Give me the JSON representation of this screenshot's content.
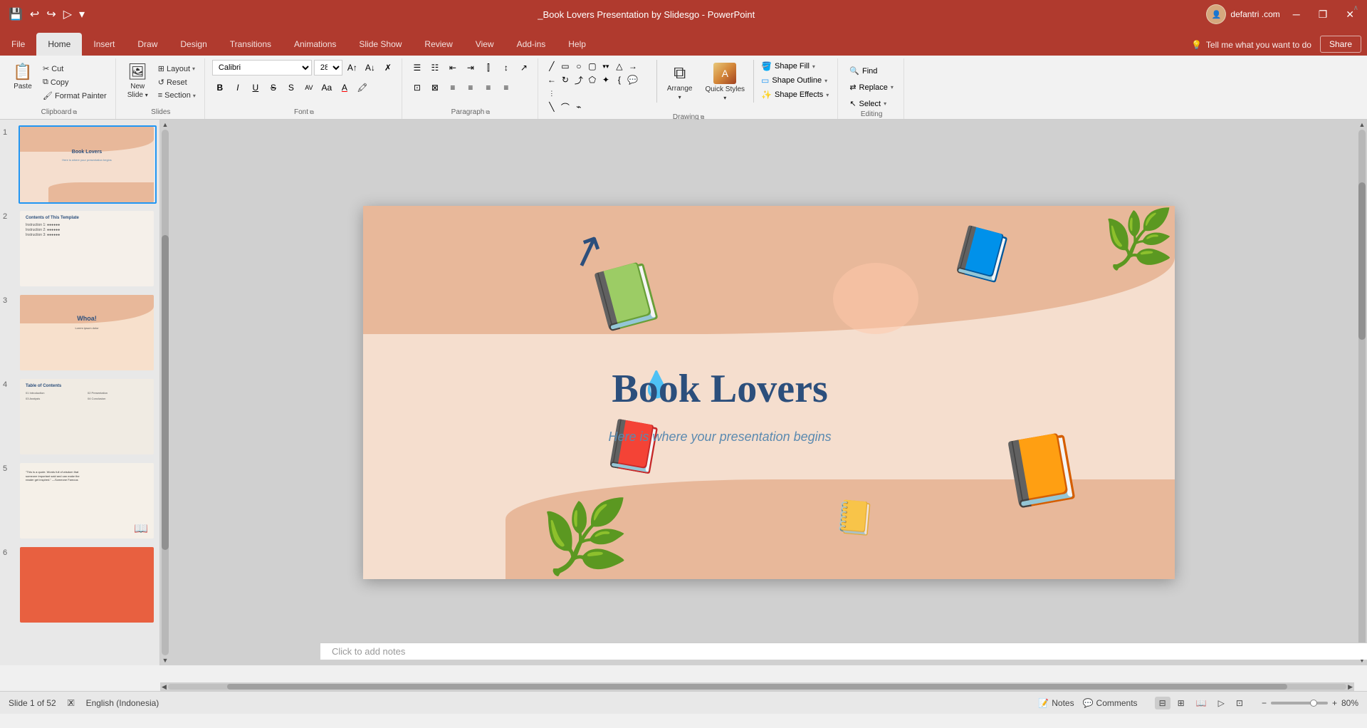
{
  "titlebar": {
    "title": "_Book Lovers Presentation by Slidesgo - PowerPoint",
    "user": "defantri .com",
    "minimize": "─",
    "restore": "❐",
    "close": "✕"
  },
  "tabs": {
    "items": [
      "File",
      "Home",
      "Insert",
      "Draw",
      "Design",
      "Transitions",
      "Animations",
      "Slide Show",
      "Review",
      "View",
      "Add-ins",
      "Help"
    ],
    "active": "Home",
    "tell_me": "Tell me what you want to do",
    "share": "Share"
  },
  "ribbon": {
    "clipboard": {
      "label": "Clipboard",
      "paste": "Paste",
      "cut": "Cut",
      "copy": "Copy",
      "format_painter": "Format Painter"
    },
    "slides": {
      "label": "Slides",
      "new_slide": "New Slide",
      "layout": "Layout",
      "reset": "Reset",
      "section": "Section"
    },
    "font": {
      "label": "Font",
      "font_name": "Calibri",
      "font_size": "28",
      "bold": "B",
      "italic": "I",
      "underline": "U",
      "strikethrough": "S",
      "shadow": "S",
      "expand": "A↕",
      "change_case": "Aa",
      "color": "A",
      "clear": "♦",
      "highlight": "A"
    },
    "paragraph": {
      "label": "Paragraph",
      "bullets": "☰",
      "numbering": "☷",
      "indent_less": "←",
      "indent_more": "→",
      "columns": "⊞",
      "align_left": "≡",
      "align_center": "≡",
      "align_right": "≡",
      "justify": "≡",
      "line_spacing": "↕",
      "text_direction": "⊡",
      "align_text": "⊠",
      "smart_art": "↗"
    },
    "drawing": {
      "label": "Drawing",
      "arrange": "Arrange",
      "quick_styles": "Quick Styles",
      "shape_fill": "Shape Fill",
      "shape_outline": "Shape Outline",
      "shape_effects": "Shape Effects"
    },
    "editing": {
      "label": "Editing",
      "find": "Find",
      "replace": "Replace",
      "select": "Select"
    }
  },
  "slides": [
    {
      "num": 1,
      "title": "Book Lovers",
      "subtitle": "Here is where your presentation begins",
      "selected": true
    },
    {
      "num": 2,
      "title": "Contents of This Template",
      "selected": false
    },
    {
      "num": 3,
      "title": "Whoa!",
      "selected": false
    },
    {
      "num": 4,
      "title": "Table of Contents",
      "selected": false
    },
    {
      "num": 5,
      "title": "",
      "selected": false
    },
    {
      "num": 6,
      "title": "",
      "selected": false
    }
  ],
  "slide": {
    "title": "Book Lovers",
    "subtitle": "Here is where your presentation begins"
  },
  "notes": {
    "placeholder": "Click to add notes",
    "label": "Notes"
  },
  "statusbar": {
    "slide_info": "Slide 1 of 52",
    "language": "English (Indonesia)",
    "notes_label": "Notes",
    "comments_label": "Comments",
    "zoom": "80%"
  }
}
